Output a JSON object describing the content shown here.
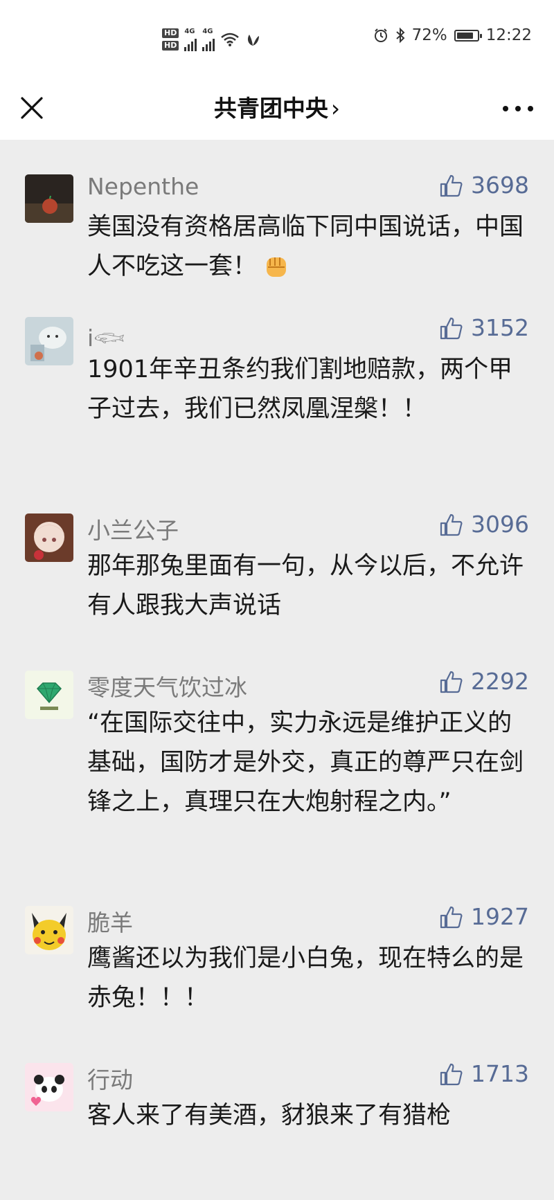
{
  "status_bar": {
    "hd1": "HD",
    "hd2": "HD",
    "net1": "4G",
    "net2": "4G",
    "battery_percent": "72%",
    "battery_level": 0.72,
    "time": "12:22"
  },
  "nav": {
    "title": "共青团中央",
    "chevron": "›"
  },
  "comments": [
    {
      "name": "Nepenthe",
      "likes": "3698",
      "text": "美国没有资格居高临下同中国说话，中国人不吃这一套！"
    },
    {
      "name": "i𓆟",
      "likes": "3152",
      "text": "1901年辛丑条约我们割地赔款，两个甲子过去，我们已然凤凰涅槃！！"
    },
    {
      "name": "小兰公子",
      "likes": "3096",
      "text": "那年那兔里面有一句，从今以后，不允许有人跟我大声说话"
    },
    {
      "name": "零度天气饮过冰",
      "likes": "2292",
      "text": "“在国际交往中，实力永远是维护正义的基础，国防才是外交，真正的尊严只在剑锋之上，真理只在大炮射程之内。”"
    },
    {
      "name": "脆羊",
      "likes": "1927",
      "text": "鹰酱还以为我们是小白兔，现在特么的是赤兔！！！"
    },
    {
      "name": "行动",
      "likes": "1713",
      "text": "客人来了有美酒，豺狼来了有猎枪"
    }
  ],
  "colors": {
    "background": "#ededed",
    "header_bg": "#ffffff",
    "like_blue": "#576b95",
    "nickname_gray": "#7a7a7a"
  },
  "icons": [
    "close-icon",
    "more-icon",
    "thumb-up-icon",
    "fist-emoji-icon",
    "alarm-icon",
    "bluetooth-icon",
    "wifi-icon",
    "battery-icon"
  ]
}
